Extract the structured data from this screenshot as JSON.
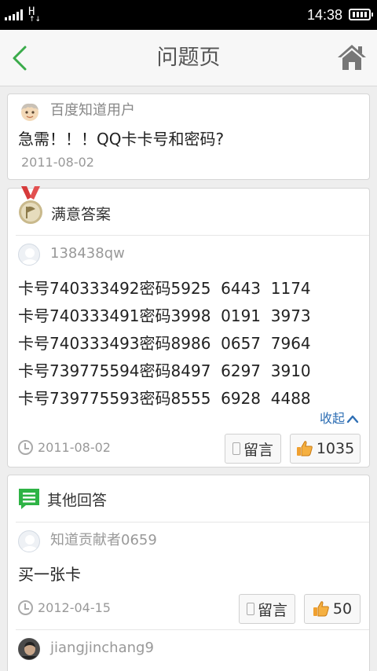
{
  "status_bar": {
    "network": "H",
    "network_arrows": "↑↓",
    "time": "14:38"
  },
  "nav": {
    "title": "问题页",
    "back_icon": "chevron-left-icon",
    "home_icon": "home-icon"
  },
  "question": {
    "user": "百度知道用户",
    "title": "急需！！！QQ卡卡号和密码?",
    "date": "2011-08-02"
  },
  "best_answer": {
    "label": "满意答案",
    "user": "138438qw",
    "lines": [
      "卡号740333492密码5925  6443  1174",
      "卡号740333491密码3998  0191  3973",
      "卡号740333493密码8986  0657  7964",
      "卡号739775594密码8497  6297  3910",
      "卡号739775593密码8555  6928  4488"
    ],
    "collapse_label": "收起",
    "date": "2011-08-02",
    "comment_label": "留言",
    "like_count": "1035"
  },
  "other_answers": {
    "label": "其他回答",
    "items": [
      {
        "user": "知道贡献者0659",
        "text": "买一张卡",
        "date": "2012-04-15",
        "comment_label": "留言",
        "like_count": "50"
      },
      {
        "user": "jiangjinchang9"
      }
    ]
  },
  "colors": {
    "accent_green": "#3aab4a",
    "link_blue": "#2f6fb4",
    "home_gray": "#777777"
  }
}
